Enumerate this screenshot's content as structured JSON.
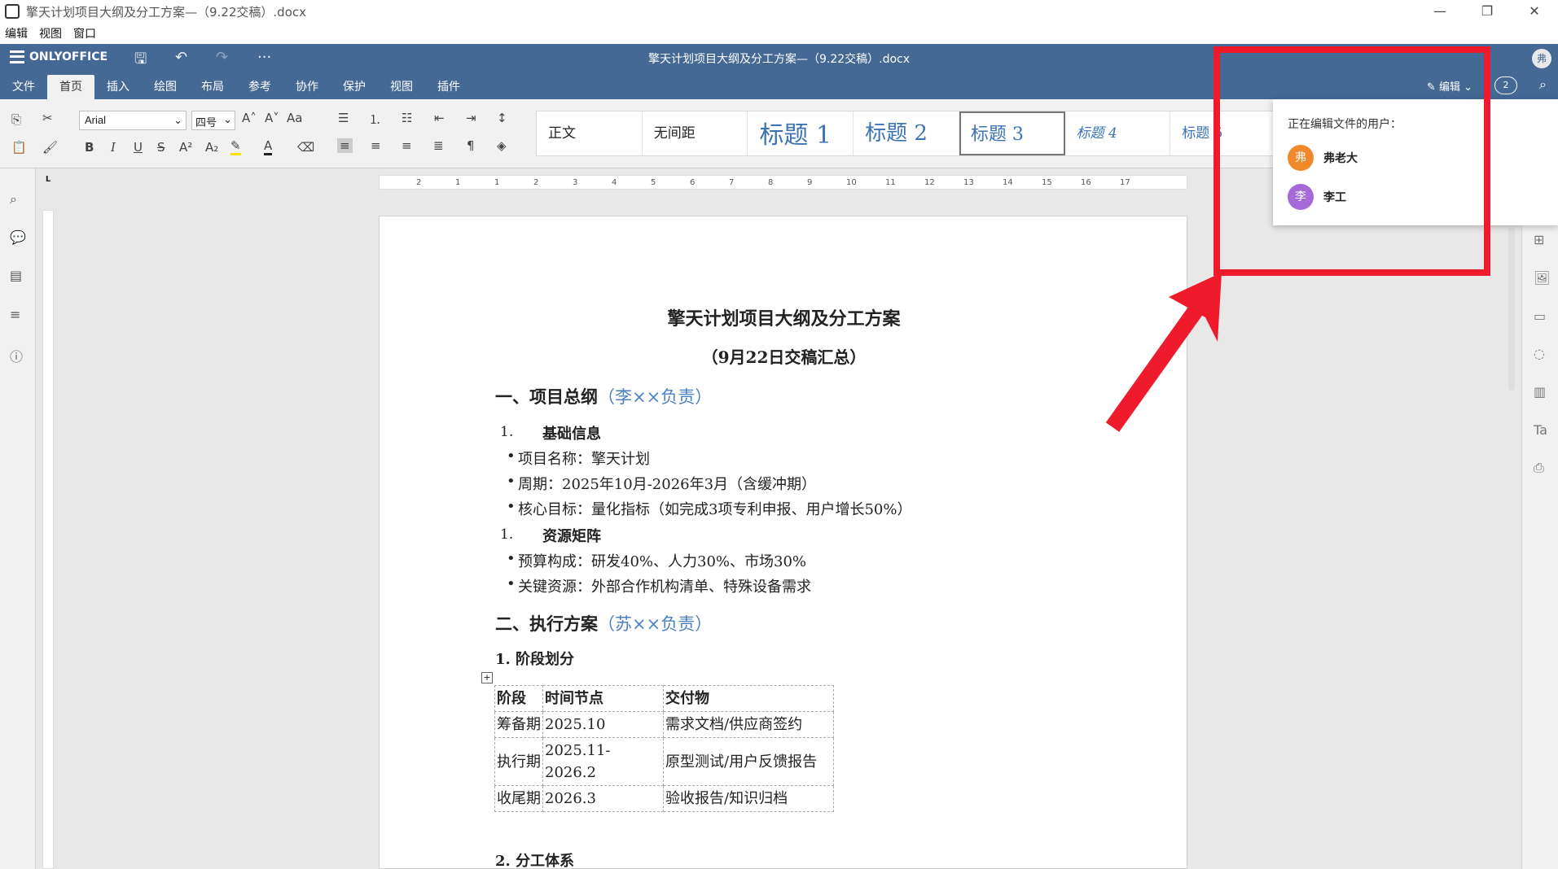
{
  "window": {
    "title": "擎天计划项目大纲及分工方案—（9.22交稿）.docx",
    "controls": [
      "—",
      "❐",
      "✕"
    ]
  },
  "menubar": [
    "编辑",
    "视图",
    "窗口"
  ],
  "header": {
    "logo": "ONLYOFFICE",
    "doc_title": "擎天计划项目大纲及分工方案—（9.22交稿）.docx",
    "user_avatar": "弗",
    "tabs": [
      "文件",
      "首页",
      "插入",
      "绘图",
      "布局",
      "参考",
      "协作",
      "保护",
      "视图",
      "插件"
    ],
    "edit_label": "编辑",
    "users_count": "2"
  },
  "toolbar": {
    "font": "Arial",
    "size": "四号",
    "styles": [
      "正文",
      "无间距",
      "标题 1",
      "标题 2",
      "标题 3",
      "标题 4",
      "标题 5"
    ]
  },
  "ruler": {
    "corner": "L",
    "ticks": [
      "2",
      "1",
      "1",
      "2",
      "3",
      "4",
      "5",
      "6",
      "7",
      "8",
      "9",
      "10",
      "11",
      "12",
      "13",
      "14",
      "15",
      "16",
      "17"
    ]
  },
  "popup": {
    "title": "正在编辑文件的用户：",
    "users": [
      {
        "initial": "弗",
        "name": "弗老大",
        "color": "#f0892c"
      },
      {
        "initial": "李",
        "name": "李工",
        "color": "#a569d8"
      }
    ]
  },
  "document": {
    "title": "擎天计划项目大纲及分工方案",
    "subtitle": "（9月22日交稿汇总）",
    "section1": {
      "heading": "一、项目总纲",
      "hint": "（李××负责）"
    },
    "item1": {
      "num": "1.",
      "label": "基础信息"
    },
    "bullets1": [
      "项目名称：擎天计划",
      "周期：2025年10月-2026年3月（含缓冲期）",
      "核心目标：量化指标（如完成3项专利申报、用户增长50%）"
    ],
    "item2": {
      "num": "1.",
      "label": "资源矩阵"
    },
    "bullets2": [
      "预算构成：研发40%、人力30%、市场30%",
      "关键资源：外部合作机构清单、特殊设备需求"
    ],
    "section2": {
      "heading": "二、执行方案",
      "hint": "（苏××负责）"
    },
    "sub1": "1. 阶段划分",
    "table": {
      "headers": [
        "阶段",
        "时间节点",
        "交付物"
      ],
      "rows": [
        [
          "筹备期",
          "2025.10",
          "需求文档/供应商签约"
        ],
        [
          "执行期",
          "2025.11-2026.2",
          "原型测试/用户反馈报告"
        ],
        [
          "收尾期",
          "2026.3",
          "验收报告/知识归档"
        ]
      ]
    },
    "sub2": "2. 分工体系"
  },
  "colors": {
    "header": "#446995",
    "highlight_box": "#ef1b2d",
    "hint_text": "#4a7fc0"
  }
}
